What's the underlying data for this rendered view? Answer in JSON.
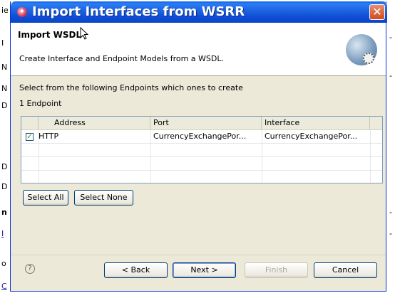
{
  "background": {
    "left_glyphs": [
      "ie",
      "I",
      "N",
      "N",
      "D",
      "D",
      "D",
      "n",
      "I",
      "o",
      "C"
    ],
    "right_glyphs": [
      "-",
      "-",
      "-",
      "-"
    ]
  },
  "dialog": {
    "title": "Import Interfaces from WSRR",
    "close_label": "✕",
    "header_title": "Import WSDL",
    "header_desc": "Create Interface and Endpoint Models from a WSDL.",
    "instruction": "Select from the following Endpoints which ones to create",
    "endpoint_count": "1 Endpoint",
    "table": {
      "columns": [
        "Address",
        "Port",
        "Interface"
      ],
      "rows": [
        {
          "checked": true,
          "address": "HTTP",
          "port": "CurrencyExchangePor...",
          "interface": "CurrencyExchangePor..."
        }
      ]
    },
    "select_all_label": "Select All",
    "select_none_label": "Select None",
    "help_label": "?",
    "back_label": "< Back",
    "next_label": "Next >",
    "finish_label": "Finish",
    "cancel_label": "Cancel"
  },
  "icons": {
    "title_icon": "wsrr-app-icon",
    "header_icon": "globe-gear-icon",
    "help_icon": "help-icon"
  },
  "colors": {
    "titlebar": "#0a45c8",
    "close": "#d14a1f",
    "window_bg": "#ece9d8",
    "table_border": "#7f9db9"
  }
}
